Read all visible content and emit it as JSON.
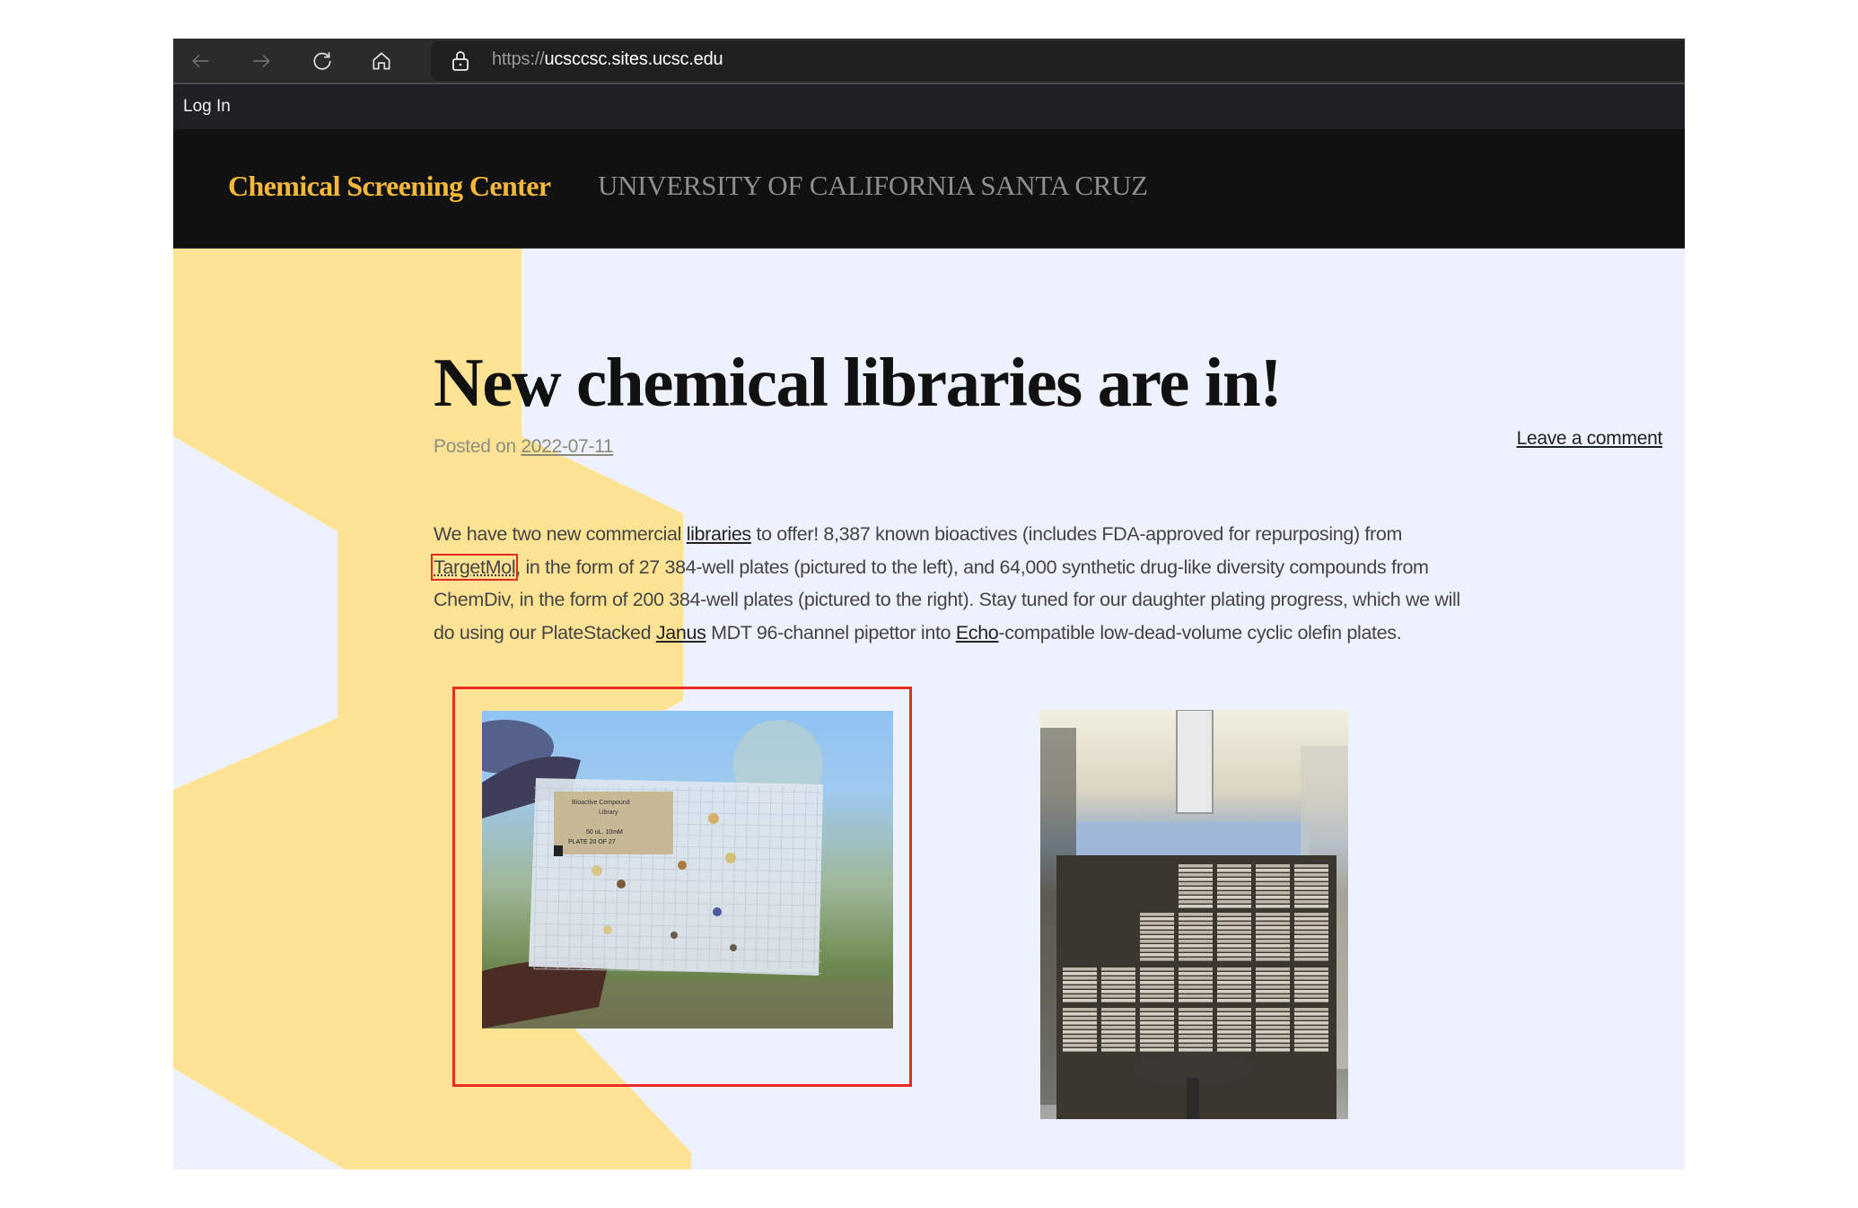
{
  "browser": {
    "url_scheme": "https://",
    "url_host": "ucsccsc.sites.ucsc.edu",
    "buttons": [
      "back",
      "forward",
      "reload",
      "home"
    ]
  },
  "adminbar": {
    "login_label": "Log In"
  },
  "site": {
    "title": "Chemical Screening Center",
    "tagline": "UNIVERSITY OF CALIFORNIA SANTA CRUZ",
    "accent_color": "#f5b83a",
    "deco_color": "#fee395",
    "page_bg": "#eef2fe"
  },
  "post": {
    "title": "New chemical libraries are in!",
    "posted_prefix": "Posted on",
    "date": "2022-07-11",
    "leave_comment": "Leave a comment",
    "body": [
      {
        "t": "We have two new commercial "
      },
      {
        "t": "libraries",
        "link": true
      },
      {
        "t": " to offer! 8,387 known bioactives (includes FDA-approved for repurposing) from "
      },
      {
        "t": "TargetMol",
        "link": true,
        "highlight": true
      },
      {
        "t": ", in the form of 27 384-well plates (pictured to the left), and 64,000 synthetic drug-like diversity compounds from ChemDiv, in the form of 200 384-well plates (pictured to the right). Stay tuned for our daughter plating progress, which we will do using our PlateStacked "
      },
      {
        "t": "Janus",
        "link": true
      },
      {
        "t": " MDT 96-channel pipettor into "
      },
      {
        "t": "Echo",
        "link": true
      },
      {
        "t": "-compatible low-dead-volume cyclic olefin plates."
      }
    ],
    "images": [
      {
        "alt": "TargetMol bioactive compound library 384-well plate held up outdoors",
        "label_lines": [
          "Bioactive Compound",
          "Library",
          "50 uL, 10mM",
          "PLATE 20 OF 27"
        ],
        "highlighted": true
      },
      {
        "alt": "Rack of ChemDiv 384-well plates in the lab"
      }
    ]
  },
  "highlight_color": "#ea2a24"
}
